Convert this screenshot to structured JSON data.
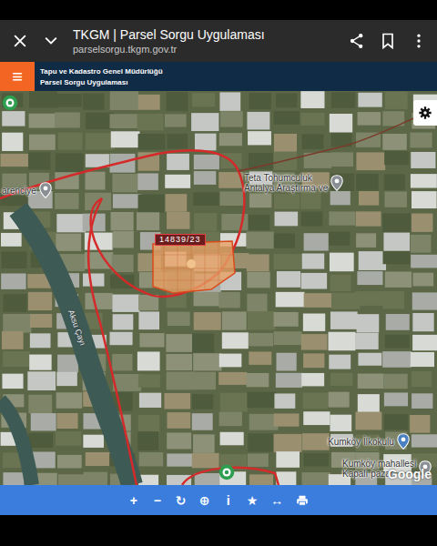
{
  "browser": {
    "title": "TKGM | Parsel Sorgu Uygulaması",
    "url": "parselsorgu.tkgm.gov.tr"
  },
  "app_header": {
    "menu": "≡",
    "organization": "Tapu ve Kadastro Genel Müdürlüğü",
    "app_name": "Parsel Sorgu Uygulaması"
  },
  "map": {
    "parcel_label": "14839/23",
    "places": [
      {
        "lines": [
          "arenciye"
        ],
        "kind": "poi"
      },
      {
        "lines": [
          "Teta Tohumculuk",
          "Antalya Araştırma ve"
        ],
        "kind": "poi"
      },
      {
        "lines": [
          "Kumköy İlkokulu"
        ],
        "kind": "school"
      },
      {
        "lines": [
          "Kumköy mahallesi",
          "Kapalı pazar"
        ],
        "kind": "poi"
      }
    ],
    "river_label": "Aksu Çayı",
    "provider": "Google"
  },
  "toolbar": [
    {
      "kind": "text",
      "label": "+"
    },
    {
      "kind": "text",
      "label": "−"
    },
    {
      "kind": "text",
      "label": "↻"
    },
    {
      "kind": "text",
      "label": "⊕"
    },
    {
      "kind": "text",
      "label": "i"
    },
    {
      "kind": "text",
      "label": "★"
    },
    {
      "kind": "text",
      "label": "↔"
    },
    {
      "kind": "print",
      "label": ""
    }
  ]
}
